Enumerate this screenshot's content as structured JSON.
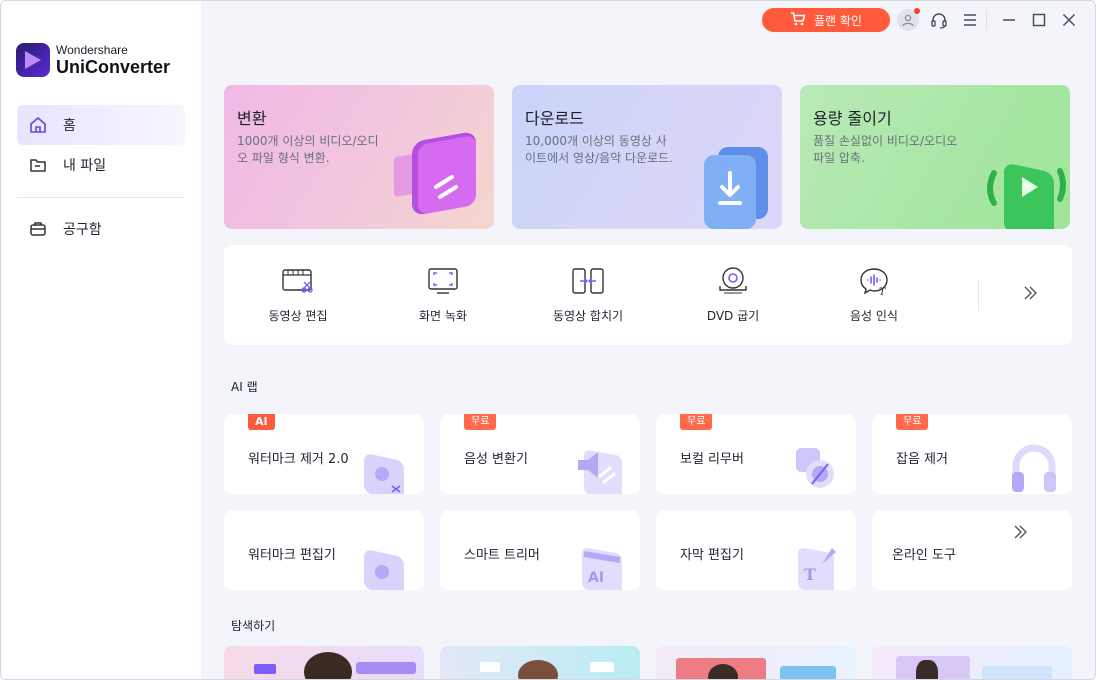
{
  "app": {
    "brand": "Wondershare",
    "product": "UniConverter"
  },
  "sidebar": {
    "items": [
      {
        "label": "홈",
        "icon": "home-icon",
        "active": true
      },
      {
        "label": "내 파일",
        "icon": "folder-icon",
        "active": false
      },
      {
        "label": "공구함",
        "icon": "toolbox-icon",
        "active": false
      }
    ]
  },
  "titlebar": {
    "plan_label": "플랜 확인",
    "icons": [
      "cart-icon",
      "user-avatar-icon",
      "headset-icon",
      "menu-icon",
      "minimize-icon",
      "maximize-icon",
      "close-icon"
    ]
  },
  "features": [
    {
      "title": "변환",
      "desc": "1000개 이상의 비디오/오디오 파일 형식 변환."
    },
    {
      "title": "다운로드",
      "desc": "10,000개 이상의 동영상 사이트에서 영상/음악 다운로드."
    },
    {
      "title": "용량 줄이기",
      "desc": "품질 손실없이 비디오/오디오 파일 압축."
    }
  ],
  "tools": [
    {
      "label": "동영상 편집",
      "icon": "video-edit-icon"
    },
    {
      "label": "화면 녹화",
      "icon": "screen-record-icon"
    },
    {
      "label": "동영상 합치기",
      "icon": "video-merge-icon"
    },
    {
      "label": "DVD 굽기",
      "icon": "dvd-burn-icon"
    },
    {
      "label": "음성 인식",
      "icon": "speech-recognition-icon"
    }
  ],
  "sections": {
    "ai_lab": "AI 랩",
    "explore": "탐색하기"
  },
  "ai_tools": [
    {
      "label": "워터마크 제거 2.0",
      "badge": "AI"
    },
    {
      "label": "음성 변환기",
      "badge": "무료"
    },
    {
      "label": "보컬 리무버",
      "badge": "무료"
    },
    {
      "label": "잡음 제거",
      "badge": "무료"
    },
    {
      "label": "워터마크 편집기",
      "badge": ""
    },
    {
      "label": "스마트 트리머",
      "badge": ""
    },
    {
      "label": "자막 편집기",
      "badge": ""
    },
    {
      "label": "온라인 도구",
      "badge": ""
    }
  ],
  "colors": {
    "accent": "#ff5a3c",
    "purple": "#7b5cf5",
    "sidebar_active": "#ece8ff"
  }
}
